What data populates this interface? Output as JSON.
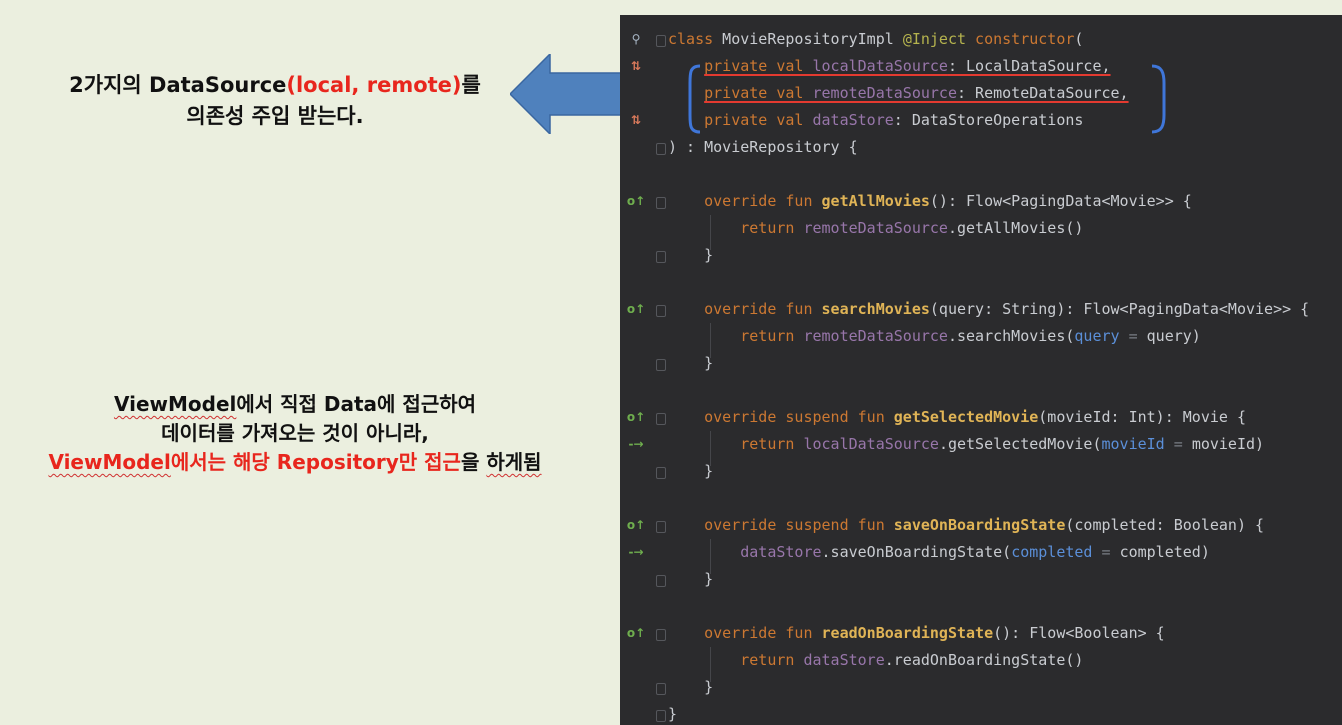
{
  "notes": {
    "note1_part1": "2가지의 DataSource",
    "note1_part2": "(local, remote)",
    "note1_part3": "를",
    "note1_line2": "의존성 주입 받는다.",
    "note2_line1_a": "ViewModel",
    "note2_line1_b": "에서 직접 Data에 접근하여",
    "note2_line2": "데이터를 가져오는 것이 아니라,",
    "note2_line3_a": "ViewModel",
    "note2_line3_b": "에서는 해당 ",
    "note2_line3_c": "Repository만 ",
    "note2_line3_d": "접근",
    "note2_line3_e": "을 ",
    "note2_line3_f": "하게됨"
  },
  "colors": {
    "background": "#ebefdf",
    "editor_bg": "#2b2b2d",
    "accent_red": "#e8261d",
    "arrow_blue": "#4f81bd",
    "bracket_blue": "#3f76d9"
  },
  "code": {
    "l1_kw": "class",
    "l1_name": " MovieRepositoryImpl ",
    "l1_ann": "@Inject",
    "l1_ctor": " constructor",
    "l1_paren": "(",
    "l2_kw": "private val ",
    "l2_prop": "localDataSource",
    "l2_type": ": LocalDataSource,",
    "l3_kw": "private val ",
    "l3_prop": "remoteDataSource",
    "l3_type": ": RemoteDataSource,",
    "l4_kw": "private val ",
    "l4_prop": "dataStore",
    "l4_type": ": DataStoreOperations",
    "l5": ") : MovieRepository {",
    "m1_kw": "override fun ",
    "m1_fn": "getAllMovies",
    "m1_sig": "(): Flow<PagingData<Movie>> {",
    "m1_ret": "return ",
    "m1_prop": "remoteDataSource",
    "m1_call": ".getAllMovies()",
    "close": "}",
    "m2_kw": "override fun ",
    "m2_fn": "searchMovies",
    "m2_sig": "(query: String): Flow<PagingData<Movie>> {",
    "m2_ret": "return ",
    "m2_prop": "remoteDataSource",
    "m2_call": ".searchMovies(",
    "m2_named": "query",
    "m2_eq": " = ",
    "m2_arg": "query)",
    "m3_kw": "override suspend fun ",
    "m3_fn": "getSelectedMovie",
    "m3_sig": "(movieId: Int): Movie {",
    "m3_ret": "return ",
    "m3_prop": "localDataSource",
    "m3_call": ".getSelectedMovie(",
    "m3_named": "movieId",
    "m3_eq": " = ",
    "m3_arg": "movieId)",
    "m4_kw": "override suspend fun ",
    "m4_fn": "saveOnBoardingState",
    "m4_sig": "(completed: Boolean) {",
    "m4_prop": "dataStore",
    "m4_call": ".saveOnBoardingState(",
    "m4_named": "completed",
    "m4_eq": " = ",
    "m4_arg": "completed)",
    "m5_kw": "override fun ",
    "m5_fn": "readOnBoardingState",
    "m5_sig": "(): Flow<Boolean> {",
    "m5_ret": "return ",
    "m5_prop": "dataStore",
    "m5_call": ".readOnBoardingState()",
    "end": "}"
  }
}
